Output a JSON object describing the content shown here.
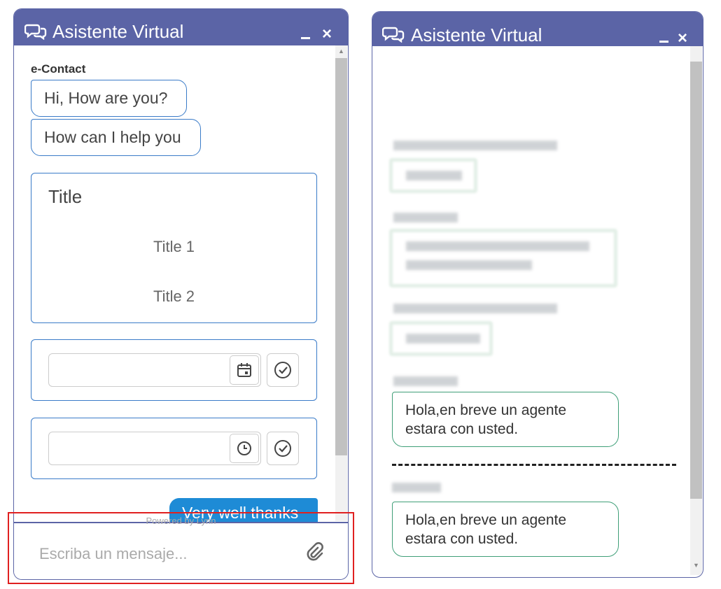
{
  "left_widget": {
    "header": {
      "title": "Asistente Virtual",
      "minimize_icon": "minimize-icon",
      "close_label": "×"
    },
    "sender": "e-Contact",
    "bot_messages": [
      "Hi, How are you?",
      "How can I help you"
    ],
    "card": {
      "title": "Title",
      "options": [
        "Title 1",
        "Title 2"
      ]
    },
    "date_field": {
      "value": "",
      "icon": "calendar-icon",
      "confirm_icon": "check-circle-icon"
    },
    "time_field": {
      "value": "",
      "icon": "clock-icon",
      "confirm_icon": "check-circle-icon"
    },
    "user_message": "Very well thanks",
    "powered_by": "Powered by Lynn",
    "input": {
      "placeholder": "Escriba un mensaje...",
      "value": ""
    },
    "attach_icon": "paperclip-icon"
  },
  "right_widget": {
    "header": {
      "title": "Asistente Virtual",
      "minimize_icon": "minimize-icon",
      "close_label": "×"
    },
    "messages": [
      "Hola,en breve un agente estara con usted.",
      "Hola,en breve un agente estara con usted."
    ]
  },
  "colors": {
    "header": "#5b64a6",
    "bot_bubble_border": "#3a7bc8",
    "user_bubble": "#1e8bd6",
    "agent_bubble_border": "#3f9f78",
    "highlight": "#e02020"
  }
}
